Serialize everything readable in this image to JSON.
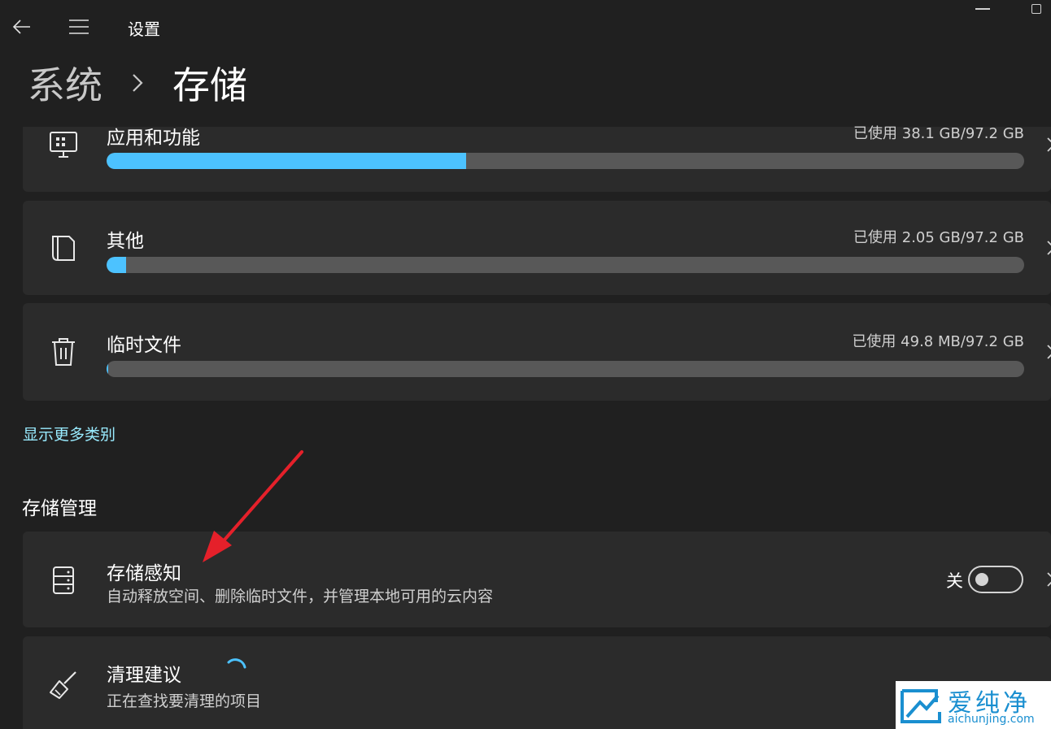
{
  "window": {
    "title": "设置"
  },
  "breadcrumb": {
    "parent": "系统",
    "current": "存储"
  },
  "categories": [
    {
      "label": "应用和功能",
      "usage": "已使用 38.1 GB/97.2 GB",
      "used_fraction": 0.392
    },
    {
      "label": "其他",
      "usage": "已使用 2.05 GB/97.2 GB",
      "used_fraction": 0.021
    },
    {
      "label": "临时文件",
      "usage": "已使用 49.8 MB/97.2 GB",
      "used_fraction": 0.0005
    }
  ],
  "show_more_link": "显示更多类别",
  "storage_management": {
    "heading": "存储管理",
    "storage_sense": {
      "title": "存储感知",
      "description": "自动释放空间、删除临时文件，并管理本地可用的云内容",
      "toggle_label": "关",
      "toggle_on": false
    },
    "cleanup": {
      "title": "清理建议",
      "description": "正在查找要清理的项目"
    }
  },
  "watermark": {
    "name": "爱纯净",
    "url": "aichunjing.com"
  },
  "colors": {
    "background": "#202020",
    "card": "#2b2b2b",
    "accent": "#4cc2ff",
    "link": "#99ebff",
    "annotation_arrow": "#e5202a"
  },
  "icons": [
    "back-arrow-icon",
    "hamburger-menu-icon",
    "chevron-right-icon",
    "apps-icon",
    "document-icon",
    "trash-icon",
    "server-icon",
    "broom-icon",
    "loading-spinner-icon"
  ]
}
